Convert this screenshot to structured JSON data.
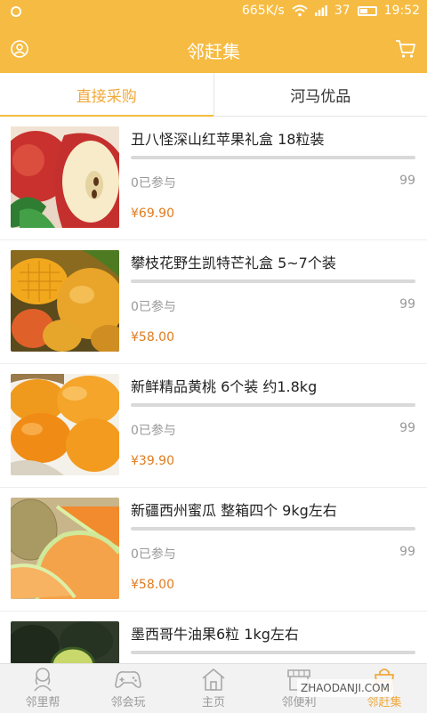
{
  "status": {
    "speed": "665K/s",
    "signal": "37",
    "time": "19:52"
  },
  "header": {
    "title": "邻赶集"
  },
  "tabs": [
    {
      "label": "直接采购",
      "active": true
    },
    {
      "label": "河马优品",
      "active": false
    }
  ],
  "products": [
    {
      "name": "丑八怪深山红苹果礼盒 18粒装",
      "joined": "0已参与",
      "stock": "99",
      "price": "¥69.90",
      "image": "apple"
    },
    {
      "name": "攀枝花野生凯特芒礼盒 5~7个装",
      "joined": "0已参与",
      "stock": "99",
      "price": "¥58.00",
      "image": "mango"
    },
    {
      "name": "新鲜精品黄桃 6个装 约1.8kg",
      "joined": "0已参与",
      "stock": "99",
      "price": "¥39.90",
      "image": "peach"
    },
    {
      "name": "新疆西州蜜瓜 整箱四个 9kg左右",
      "joined": "0已参与",
      "stock": "99",
      "price": "¥58.00",
      "image": "melon"
    },
    {
      "name": "墨西哥牛油果6粒 1kg左右",
      "joined": "",
      "stock": "",
      "price": "",
      "image": "avocado"
    }
  ],
  "bottom_nav": [
    {
      "label": "邻里帮",
      "icon": "neighbor-icon",
      "active": false
    },
    {
      "label": "邻会玩",
      "icon": "gamepad-icon",
      "active": false
    },
    {
      "label": "主页",
      "icon": "home-icon",
      "active": false
    },
    {
      "label": "邻便利",
      "icon": "store-icon",
      "active": false
    },
    {
      "label": "邻赶集",
      "icon": "market-bag-icon",
      "active": true
    }
  ],
  "watermark": "ZHAODANJI.COM",
  "colors": {
    "brand": "#f6bb42",
    "accent_text": "#f0a93b",
    "price": "#e07b1f"
  }
}
